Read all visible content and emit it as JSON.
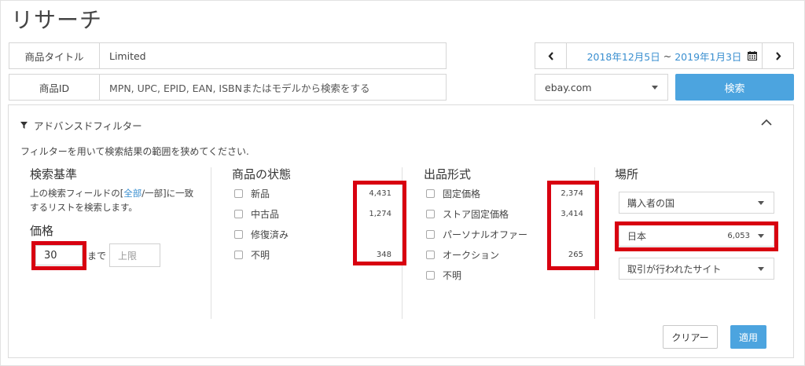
{
  "page": {
    "title": "リサーチ"
  },
  "search": {
    "title_label": "商品タイトル",
    "title_value": "Limited",
    "id_label": "商品ID",
    "id_placeholder": "MPN, UPC, EPID, EAN, ISBNまたはモデルから検索をする",
    "date_from": "2018年12月5日",
    "date_sep": "~",
    "date_to": "2019年1月3日",
    "site": "ebay.com",
    "search_button": "検索"
  },
  "advanced": {
    "header": "アドバンスドフィルター",
    "description": "フィルターを用いて検索結果の範囲を狭めてください."
  },
  "criteria": {
    "title": "検索基準",
    "desc_line1_pre": "上の検索フィールドの[",
    "desc_all": "全部",
    "desc_line1_post": "/一部]に一致",
    "desc_line2": "するリストを検索します。",
    "price_title": "価格",
    "price_min": "30",
    "price_to": "まで",
    "price_max_placeholder": "上限"
  },
  "condition": {
    "title": "商品の状態",
    "items": [
      {
        "label": "新品",
        "count": "4,431"
      },
      {
        "label": "中古品",
        "count": "1,274"
      },
      {
        "label": "修復済み",
        "count": ""
      },
      {
        "label": "不明",
        "count": "348"
      }
    ]
  },
  "format": {
    "title": "出品形式",
    "items": [
      {
        "label": "固定価格",
        "count": "2,374"
      },
      {
        "label": "ストア固定価格",
        "count": "3,414"
      },
      {
        "label": "パーソナルオファー",
        "count": ""
      },
      {
        "label": "オークション",
        "count": "265"
      },
      {
        "label": "不明",
        "count": ""
      }
    ]
  },
  "location": {
    "title": "場所",
    "buyer_country": "購入者の国",
    "country": "日本",
    "country_count": "6,053",
    "site_placeholder": "取引が行われたサイト"
  },
  "actions": {
    "clear": "クリアー",
    "apply": "適用"
  },
  "colors": {
    "accent": "#4ca4df",
    "link": "#3a8fd0",
    "highlight": "#d80010"
  }
}
